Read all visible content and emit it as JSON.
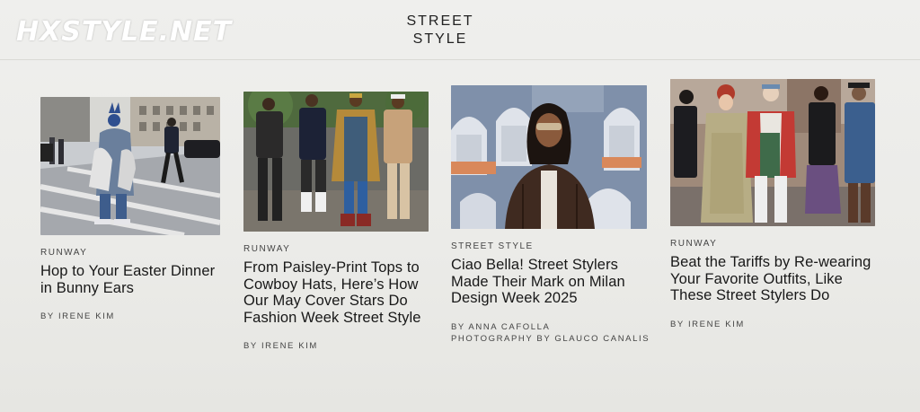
{
  "watermark": "HXSTYLE.NET",
  "section": {
    "title_line1": "STREET",
    "title_line2": "STYLE"
  },
  "articles": [
    {
      "category": "RUNWAY",
      "headline": "Hop to Your Easter Dinner in Bunny Ears",
      "byline_1": "BY IRENE KIM",
      "byline_2": ""
    },
    {
      "category": "RUNWAY",
      "headline": "From Paisley-Print Tops to Cowboy Hats, Here’s How Our May Cover Stars Do Fashion Week Street Style",
      "byline_1": "BY IRENE KIM",
      "byline_2": ""
    },
    {
      "category": "STREET STYLE",
      "headline": "Ciao Bella! Street Stylers Made Their Mark on Milan Design Week 2025",
      "byline_1": "BY ANNA CAFOLLA",
      "byline_2": "PHOTOGRAPHY BY GLAUCO CANALIS"
    },
    {
      "category": "RUNWAY",
      "headline": "Beat the Tariffs by Re-wearing Your Favorite Outfits, Like These Street Stylers Do",
      "byline_1": "BY IRENE KIM",
      "byline_2": ""
    }
  ]
}
